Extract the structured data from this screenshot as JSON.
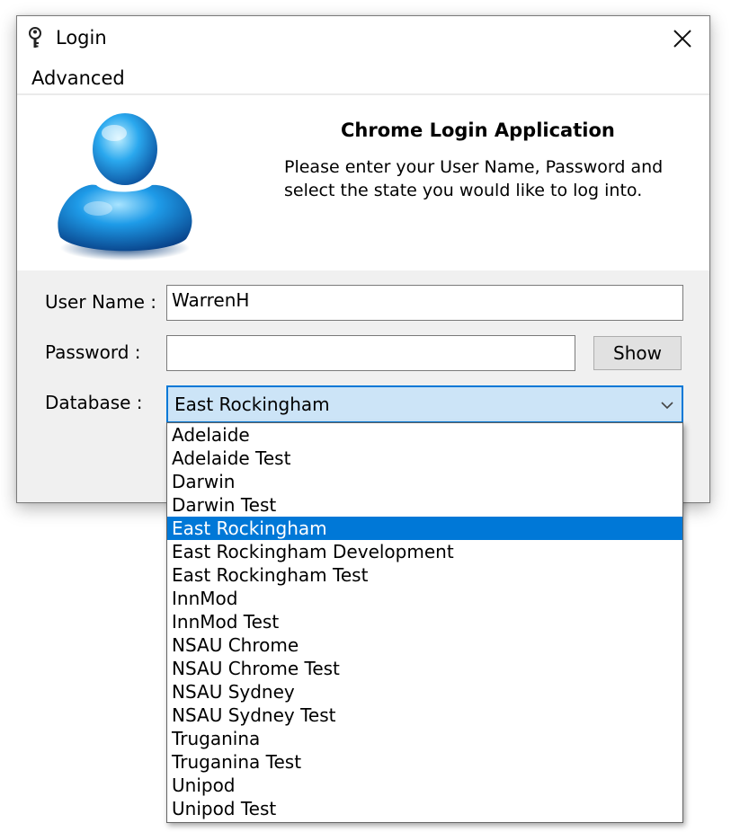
{
  "window": {
    "title": "Login"
  },
  "menu": {
    "advanced": "Advanced"
  },
  "header": {
    "heading": "Chrome Login Application",
    "description": "Please enter your User Name, Password and select the state you would like to log into."
  },
  "form": {
    "username_label": "User Name :",
    "username_value": "WarrenH",
    "password_label": "Password :",
    "password_value": "",
    "show_label": "Show",
    "database_label": "Database :",
    "database_value": "East Rockingham"
  },
  "database_options": [
    "Adelaide",
    "Adelaide Test",
    "Darwin",
    "Darwin Test",
    "East Rockingham",
    "East Rockingham Development",
    "East Rockingham Test",
    "InnMod",
    "InnMod Test",
    "NSAU Chrome",
    "NSAU Chrome Test",
    "NSAU Sydney",
    "NSAU Sydney Test",
    "Truganina",
    "Truganina Test",
    "Unipod",
    "Unipod Test"
  ],
  "selected_option_index": 4,
  "icons": {
    "app": "key-icon",
    "close": "close-icon",
    "user": "user-avatar-icon",
    "arrow": "chevron-down-icon"
  },
  "colors": {
    "accent": "#0078d7",
    "combo_bg": "#cce4f7"
  }
}
